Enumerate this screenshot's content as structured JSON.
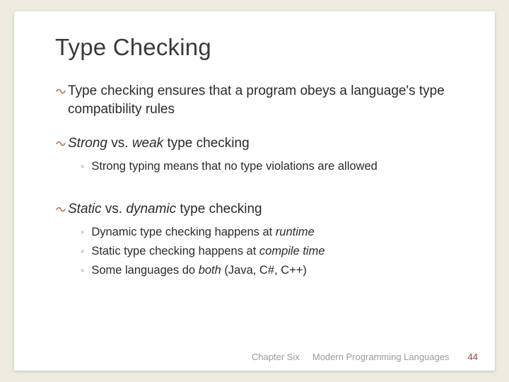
{
  "slide": {
    "title": "Type Checking",
    "bullets": [
      {
        "text_parts": [
          {
            "text": "Type checking ensures that a program obeys a language's type compatibility rules",
            "italic": false
          }
        ],
        "subitems": []
      },
      {
        "text_parts": [
          {
            "text": "Strong",
            "italic": true
          },
          {
            "text": " vs. ",
            "italic": false
          },
          {
            "text": "weak",
            "italic": true
          },
          {
            "text": " type checking",
            "italic": false
          }
        ],
        "subitems": [
          {
            "parts": [
              {
                "text": "Strong typing means that no type violations are allowed",
                "italic": false
              }
            ]
          }
        ]
      },
      {
        "text_parts": [
          {
            "text": "Static",
            "italic": true
          },
          {
            "text": " vs. ",
            "italic": false
          },
          {
            "text": "dynamic",
            "italic": true
          },
          {
            "text": " type checking",
            "italic": false
          }
        ],
        "subitems": [
          {
            "parts": [
              {
                "text": "Dynamic type checking happens at ",
                "italic": false
              },
              {
                "text": "runtime",
                "italic": true
              }
            ]
          },
          {
            "parts": [
              {
                "text": "Static type checking happens at ",
                "italic": false
              },
              {
                "text": "compile time",
                "italic": true
              }
            ]
          },
          {
            "parts": [
              {
                "text": "Some languages do ",
                "italic": false
              },
              {
                "text": "both",
                "italic": true
              },
              {
                "text": " (Java, C#, C++)",
                "italic": false
              }
            ]
          }
        ]
      }
    ]
  },
  "footer": {
    "chapter": "Chapter Six",
    "book": "Modern Programming Languages",
    "page": "44"
  },
  "glyphs": {
    "main_bullet": "༒",
    "sub_bullet": "◦"
  }
}
